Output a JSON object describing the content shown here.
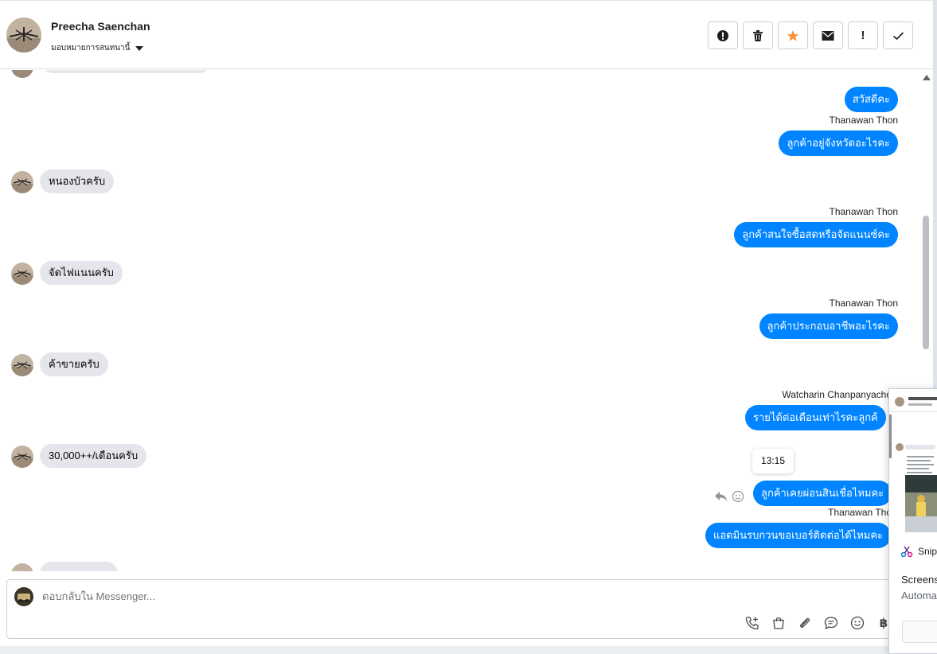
{
  "contact": {
    "name": "Preecha Saenchan",
    "assign_label": "มอบหมายการสนทนานี้"
  },
  "toolbar": [
    {
      "name": "report-button",
      "icon": "spam-icon",
      "glyph": "❗"
    },
    {
      "name": "delete-button",
      "icon": "trash-icon",
      "glyph": "🗑"
    },
    {
      "name": "star-button",
      "icon": "star-icon",
      "glyph": "★"
    },
    {
      "name": "mark-unread-button",
      "icon": "envelope-icon",
      "glyph": "✉"
    },
    {
      "name": "follow-up-button",
      "icon": "exclamation-icon",
      "glyph": "!"
    },
    {
      "name": "done-button",
      "icon": "check-icon",
      "glyph": "✓"
    }
  ],
  "messages": {
    "out_1": "สวัสดีคะ",
    "sender_1": "Thanawan Thon",
    "out_2": "ลูกค้าอยู่จังหวัดอะไรคะ",
    "in_1": "หนองบัวครับ",
    "sender_2": "Thanawan Thon",
    "out_3": "ลูกค้าสนใจซื้อสดหรือจัดแนนซ์คะ",
    "in_2": "จัดไฟแนนครับ",
    "sender_3": "Thanawan Thon",
    "out_4": "ลูกค้าประกอบอาชีพอะไรคะ",
    "in_3": "ค้าขายครับ",
    "sender_4": "Watcharin Chanpanyacho",
    "out_5": "รายได้ต่อเดือนเท่าไรคะลูกค้",
    "in_4": "30,000++/เดือนครับ",
    "timestamp": "13:15",
    "out_6": "ลูกค้าเคยผ่อนสินเชื่อไหมคะ",
    "sender_5": "Thanawan Tho",
    "out_7": "แอดมินรบกวนขอเบอร์ติดต่อได้ไหมคะ"
  },
  "composer": {
    "placeholder": "ตอบกลับใน Messenger...",
    "tools": [
      "call-icon",
      "shop-icon",
      "attach-icon",
      "saved-reply-icon",
      "emoji-icon",
      "payment-icon"
    ]
  },
  "notification": {
    "app_name": "Snip",
    "title": "Screens",
    "subtitle": "Automa"
  },
  "colors": {
    "accent": "#0084ff",
    "incoming": "#e4e6eb",
    "star": "#f7923b"
  }
}
